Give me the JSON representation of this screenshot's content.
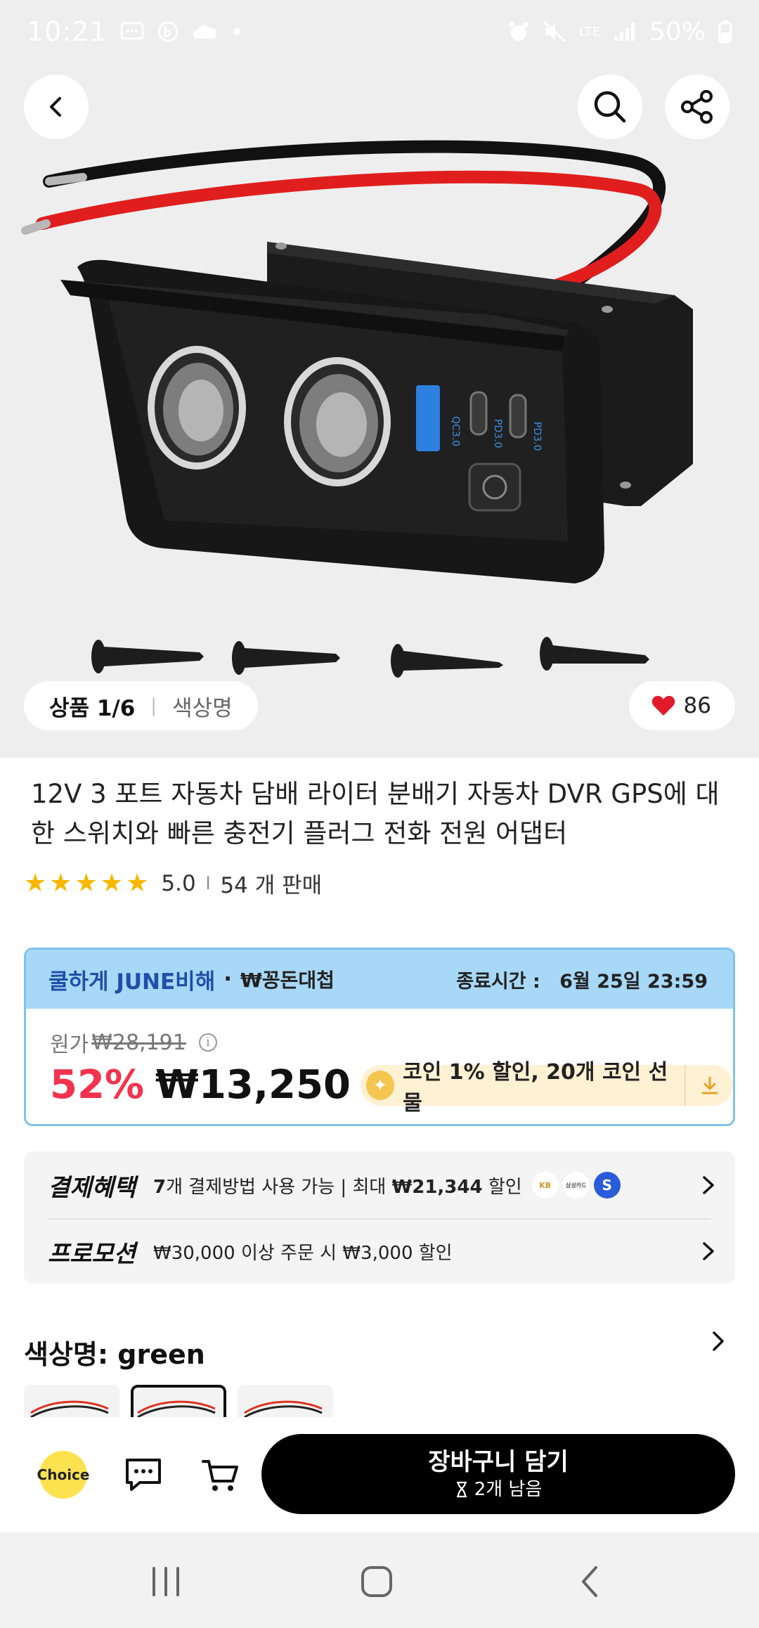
{
  "status_bar": {
    "time": "10:21",
    "network": "LTE",
    "battery": "50%"
  },
  "hero": {
    "counter_label": "상품 1/6",
    "counter_sep": "|",
    "counter_sub": "색상명",
    "like_count": "86",
    "product_labels": {
      "port1": "QC3.0",
      "port2": "PD3.0",
      "port3": "PD3.0"
    }
  },
  "product": {
    "title": "12V 3 포트 자동차 담배 라이터 분배기 자동차 DVR GPS에 대 한 스위치와 빠른 충전기 플러그 전화 전원 어댑터",
    "rating": "5.0",
    "rating_sep": "l",
    "sold": "54 개 판매",
    "stars": 5
  },
  "sale": {
    "brand": "쿨하게 JUNE비해",
    "brand_dot": "·",
    "brand_sub": "₩꽁돈대첩",
    "end_label": "종료시간 :",
    "end_time": "6월 25일 23:59",
    "orig_label": "원가",
    "orig_price": "₩28,191",
    "info_glyph": "i",
    "discount": "52%",
    "price": "₩13,250",
    "coin_glyph": "✦",
    "coin_text": "코인 1% 할인,  20개 코인 선물"
  },
  "benefits": {
    "payment_label": "결제혜택",
    "payment_count": "7",
    "payment_text": "개 결제방법 사용 가능 | 최대 ",
    "payment_max": "₩21,344",
    "payment_suffix": " 할인",
    "card_logos": [
      "KB",
      "삼성카드",
      "S"
    ],
    "promo_label": "프로모션",
    "promo_text": "₩30,000 이상 주문 시 ₩3,000 할인"
  },
  "option": {
    "color_label": "색상명: green"
  },
  "actions": {
    "choice_label": "Choice",
    "cta_main": "장바구니 담기",
    "cta_sub": "2개 남음"
  },
  "colors": {
    "accent_red": "#f3334d",
    "sale_header": "#a8d8f7",
    "brand_blue": "#1f4fa8",
    "coin_bg": "#fff1d3",
    "star": "#f6b800"
  }
}
